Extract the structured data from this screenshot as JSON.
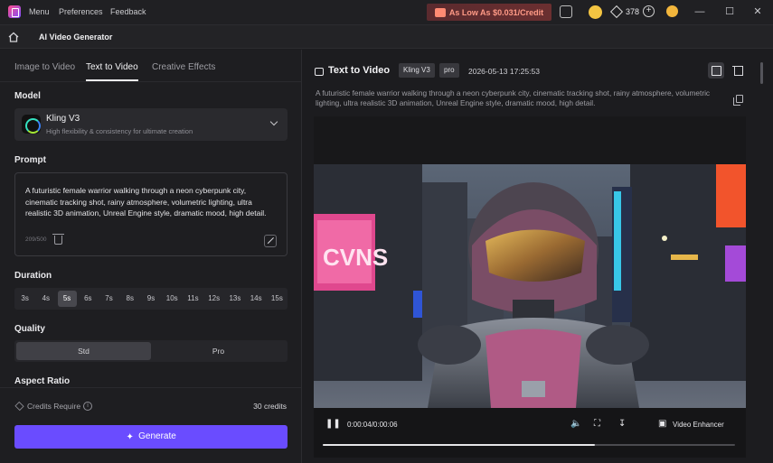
{
  "titlebar": {
    "menu_items": [
      "Menu",
      "Preferences",
      "Feedback"
    ],
    "promo_text": "As Low As $0.031/Credit",
    "credits_count": "378",
    "window_controls": [
      "minimize-icon",
      "maximize-icon",
      "close-icon"
    ]
  },
  "navbar": {
    "title": "AI Video Generator"
  },
  "left": {
    "tabs": [
      {
        "label": "Image to Video",
        "active": false
      },
      {
        "label": "Text to Video",
        "active": true
      },
      {
        "label": "Creative Effects",
        "active": false
      }
    ],
    "model_title": "Model",
    "model": {
      "name": "Kling V3",
      "description": "High flexibility & consistency for ultimate creation"
    },
    "prompt_title": "Prompt",
    "prompt": {
      "text": "A futuristic female warrior walking through a neon cyberpunk city, cinematic tracking shot, rainy atmosphere, volumetric lighting, ultra realistic 3D animation, Unreal Engine style, dramatic mood, high detail.",
      "count": "209/500"
    },
    "duration_title": "Duration",
    "durations": [
      "3s",
      "4s",
      "5s",
      "6s",
      "7s",
      "8s",
      "9s",
      "10s",
      "11s",
      "12s",
      "13s",
      "14s",
      "15s"
    ],
    "duration_selected": "5s",
    "quality_title": "Quality",
    "quality_options": [
      "Std",
      "Pro"
    ],
    "quality_selected": "Std",
    "aspect_title": "Aspect Ratio",
    "credits_label": "Credits Require",
    "credits_value": "30 credits",
    "generate_label": "Generate"
  },
  "right": {
    "title": "Text to Video",
    "model_chip": "Kling V3",
    "quality_chip": "pro",
    "date": "2026-05-13 17:25:53",
    "prompt": "A futuristic female warrior walking through a neon cyberpunk city, cinematic tracking shot, rainy atmosphere, volumetric lighting, ultra realistic 3D animation, Unreal Engine style, dramatic mood, high detail.",
    "player": {
      "time": "0:00:04/0:00:06",
      "progress": 0.66,
      "enhancer_label": "Video Enhancer"
    }
  },
  "colors": {
    "accent": "#6a4cff",
    "background": "#1c1c1f"
  }
}
